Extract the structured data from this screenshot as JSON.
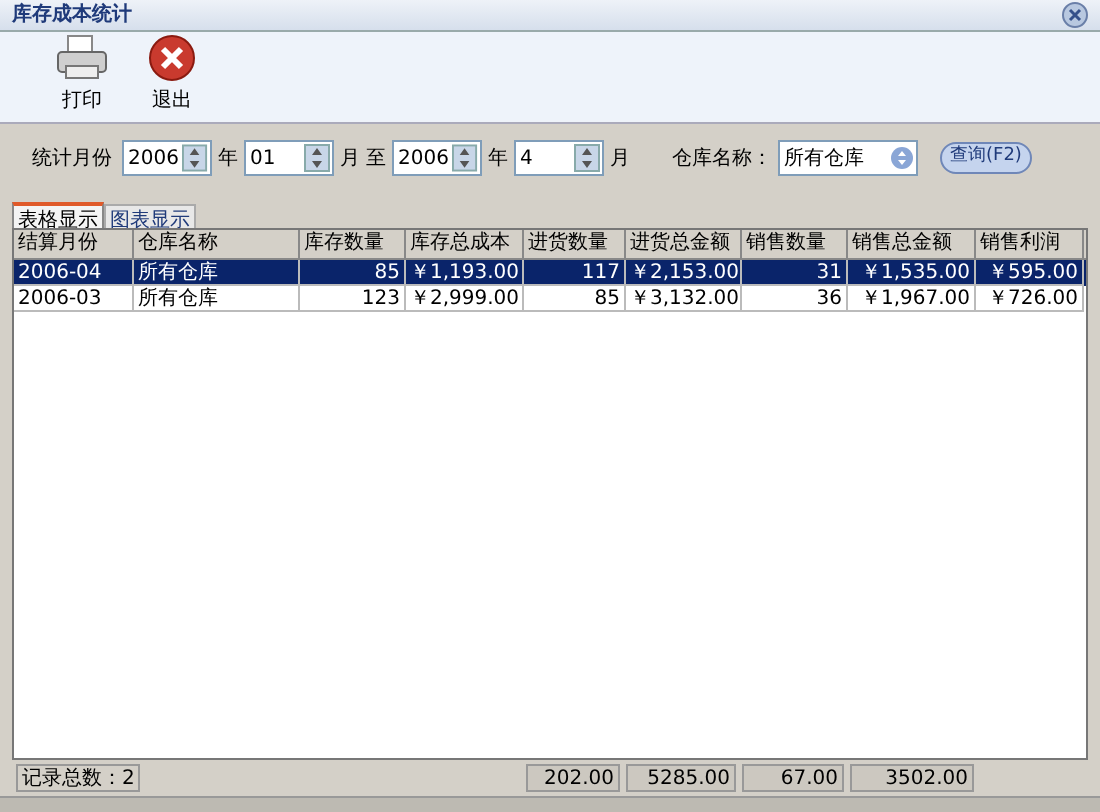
{
  "window": {
    "title": "库存成本统计"
  },
  "toolbar": [
    {
      "kind": "print",
      "label": "打印"
    },
    {
      "kind": "exit",
      "label": "退出"
    }
  ],
  "filter": {
    "label": "统计月份",
    "from_year": "2006",
    "year_label_1": "年",
    "from_month": "01",
    "month_label_1": "月",
    "to_label": "至",
    "to_year": "2006",
    "year_label_2": "年",
    "to_month": "4",
    "month_label_2": "月",
    "warehouse_label": "仓库名称：",
    "warehouse": "所有仓库",
    "query_button": "查询(F2)"
  },
  "tabs": [
    {
      "label": "表格显示",
      "selected": true
    },
    {
      "label": "图表显示",
      "selected": false
    }
  ],
  "table": {
    "columns": [
      "结算月份",
      "仓库名称",
      "库存数量",
      "库存总成本",
      "进货数量",
      "进货总金额",
      "销售数量",
      "销售总金额",
      "销售利润"
    ],
    "rows": [
      {
        "selected": true,
        "cells": [
          "2006-04",
          "所有仓库",
          "85",
          "￥1,193.00",
          "117",
          "￥2,153.00",
          "31",
          "￥1,535.00",
          "￥595.00"
        ]
      },
      {
        "selected": false,
        "cells": [
          "2006-03",
          "所有仓库",
          "123",
          "￥2,999.00",
          "85",
          "￥3,132.00",
          "36",
          "￥1,967.00",
          "￥726.00"
        ]
      }
    ]
  },
  "footer": {
    "record_count": "记录总数：2",
    "totals": [
      "202.00",
      "5285.00",
      "67.00",
      "3502.00"
    ]
  }
}
